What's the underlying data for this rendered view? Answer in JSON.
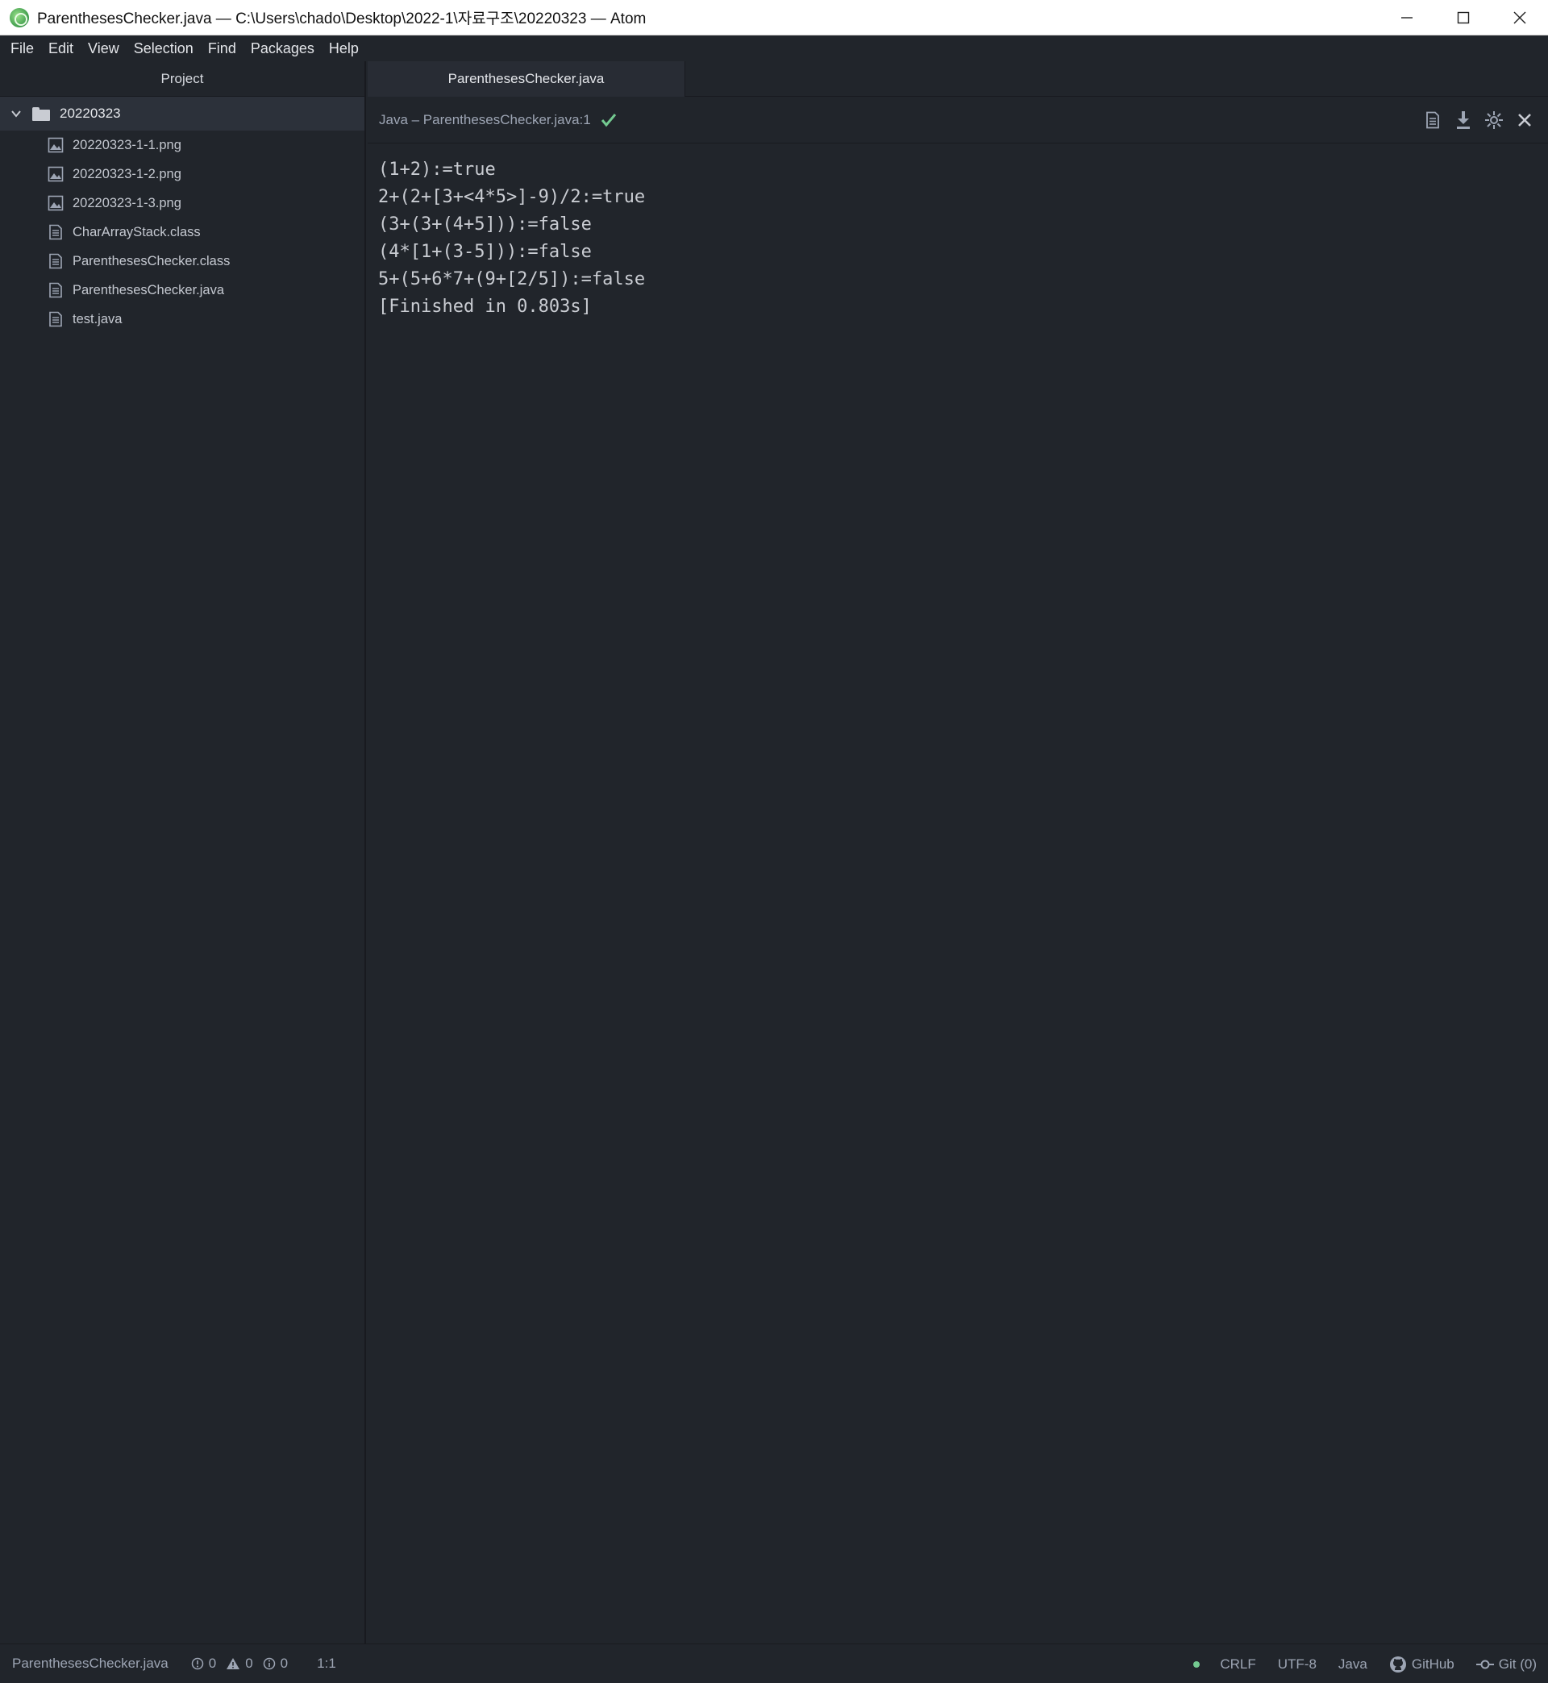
{
  "window": {
    "title": "ParenthesesChecker.java — C:\\Users\\chado\\Desktop\\2022-1\\자료구조\\20220323 — Atom"
  },
  "menu": [
    "File",
    "Edit",
    "View",
    "Selection",
    "Find",
    "Packages",
    "Help"
  ],
  "sidebar": {
    "header": "Project",
    "root": "20220323",
    "items": [
      {
        "label": "20220323-1-1.png",
        "icon": "image-file-icon"
      },
      {
        "label": "20220323-1-2.png",
        "icon": "image-file-icon"
      },
      {
        "label": "20220323-1-3.png",
        "icon": "image-file-icon"
      },
      {
        "label": "CharArrayStack.class",
        "icon": "text-file-icon"
      },
      {
        "label": "ParenthesesChecker.class",
        "icon": "text-file-icon"
      },
      {
        "label": "ParenthesesChecker.java",
        "icon": "text-file-icon"
      },
      {
        "label": "test.java",
        "icon": "text-file-icon"
      }
    ]
  },
  "tabs": [
    {
      "label": "ParenthesesChecker.java"
    }
  ],
  "panel": {
    "title": "Java – ParenthesesChecker.java:1",
    "status_icon": "check-icon",
    "tools": [
      "copy-output-icon",
      "download-icon",
      "settings-icon",
      "close-icon"
    ]
  },
  "output": {
    "lines": [
      "(1+2):=true",
      "2+(2+[3+<4*5>]-9)/2:=true",
      "(3+(3+(4+5])):=false",
      "(4*[1+(3-5])):=false",
      "5+(5+6*7+(9+[2/5]):=false",
      "[Finished in 0.803s]"
    ]
  },
  "status": {
    "file": "ParenthesesChecker.java",
    "errors": "0",
    "warnings": "0",
    "infos": "0",
    "cursor": "1:1",
    "line_ending": "CRLF",
    "encoding": "UTF-8",
    "grammar": "Java",
    "github": "GitHub",
    "git": "Git (0)"
  },
  "colors": {
    "background": "#21252b",
    "accent_green": "#73c990",
    "text": "#c9ccd2"
  }
}
